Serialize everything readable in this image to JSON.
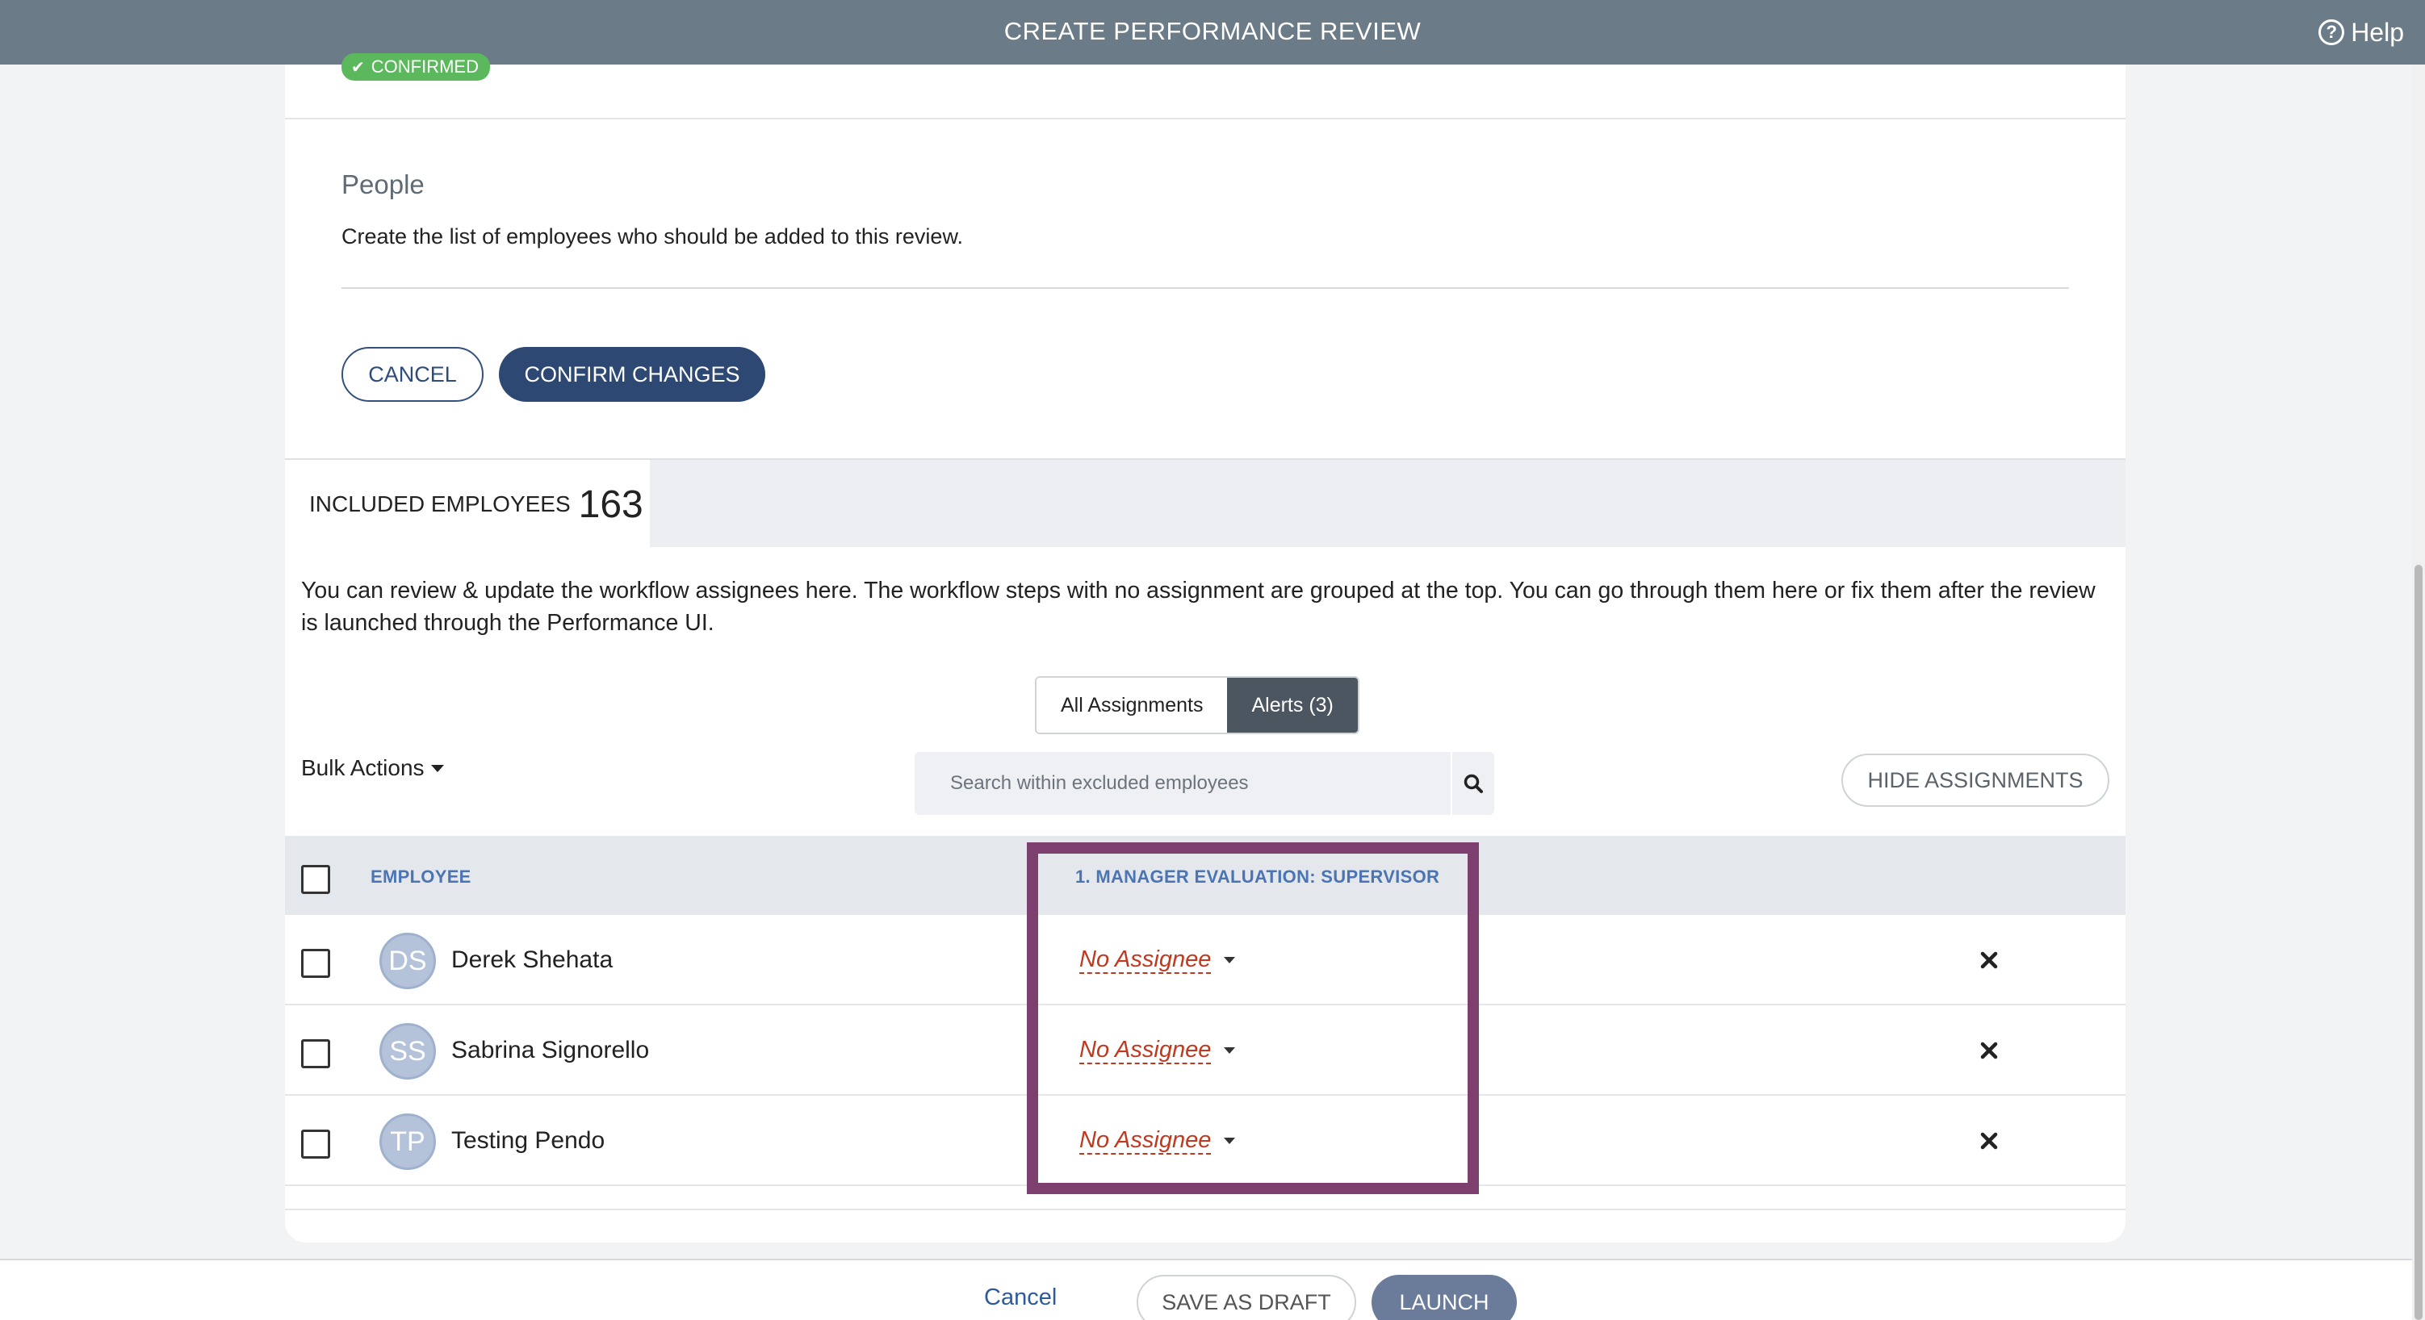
{
  "header": {
    "title": "CREATE PERFORMANCE REVIEW",
    "help_label": "Help",
    "help_icon": "question-circle-icon"
  },
  "status_badge": {
    "label": "CONFIRMED",
    "color": "#5cb85c"
  },
  "people": {
    "title": "People",
    "description": "Create the list of employees who should be added to this review.",
    "cancel_label": "CANCEL",
    "confirm_label": "CONFIRM CHANGES"
  },
  "tab": {
    "label": "INCLUDED EMPLOYEES",
    "count": "163"
  },
  "intro_text": "You can review & update the workflow assignees here. The workflow steps with no assignment are grouped at the top. You can go through them here or fix them after the review is launched through the Performance UI.",
  "filter": {
    "all_label": "All Assignments",
    "alerts_label": "Alerts (3)",
    "selected": "Alerts (3)"
  },
  "bulk_actions_label": "Bulk Actions",
  "search": {
    "placeholder": "Search within excluded employees"
  },
  "hide_assignments_label": "HIDE ASSIGNMENTS",
  "table": {
    "columns": {
      "employee": "EMPLOYEE",
      "step": "1. MANAGER EVALUATION: SUPERVISOR"
    },
    "rows": [
      {
        "initials": "DS",
        "name": "Derek Shehata",
        "assignee": "No Assignee"
      },
      {
        "initials": "SS",
        "name": "Sabrina Signorello",
        "assignee": "No Assignee"
      },
      {
        "initials": "TP",
        "name": "Testing Pendo",
        "assignee": "No Assignee"
      }
    ]
  },
  "footer": {
    "cancel_label": "Cancel",
    "save_draft_label": "SAVE AS DRAFT",
    "launch_label": "LAUNCH"
  },
  "colors": {
    "topbar": "#6b7b87",
    "primary": "#2d4873",
    "alert_text": "#c0391f",
    "highlight": "#7d3f6d"
  }
}
